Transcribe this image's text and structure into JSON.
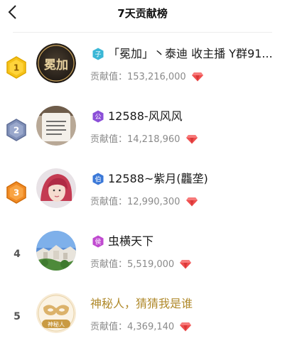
{
  "header": {
    "title": "7天贡献榜"
  },
  "rows": [
    {
      "rank": "1",
      "badge": "子",
      "name": "「冕加」丶泰迪 收主播 Y群91...",
      "contribution": "贡献值：153,216,000",
      "badge_color": "#3ab7d6",
      "avatar_text": "冕加"
    },
    {
      "rank": "2",
      "badge": "公",
      "name": "12588-风风风",
      "contribution": "贡献值：14,218,960",
      "badge_color": "#8b4fd8"
    },
    {
      "rank": "3",
      "badge": "伯",
      "name": "12588~紫月(龘垄)",
      "contribution": "贡献值：12,990,300",
      "badge_color": "#3a78d8"
    },
    {
      "rank": "4",
      "badge": "侯",
      "name": "虫横天下",
      "contribution": "贡献值：5,519,000",
      "badge_color": "#c04ad0"
    },
    {
      "rank": "5",
      "name": "神秘人，猜猜我是谁",
      "contribution": "贡献值：4,369,140",
      "avatar_label": "神秘人"
    }
  ]
}
